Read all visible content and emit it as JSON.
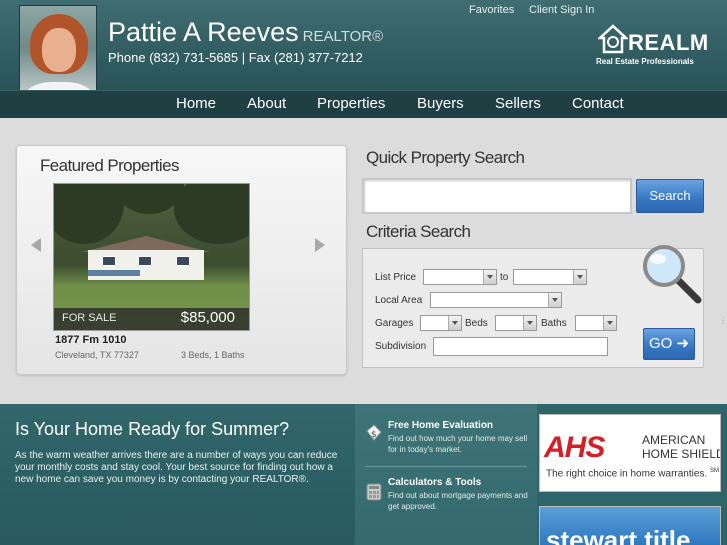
{
  "header": {
    "agent_name": "Pattie A Reeves",
    "designation": "REALTOR®",
    "contact_line": "Phone (832) 731-5685 | Fax (281) 377-7212",
    "top_links": [
      "Favorites",
      "Client Sign In"
    ],
    "logo": {
      "brand": "REALM",
      "tagline": "Real Estate Professionals"
    }
  },
  "nav": [
    "Home",
    "About",
    "Properties",
    "Buyers",
    "Sellers",
    "Contact"
  ],
  "featured": {
    "title": "Featured Properties",
    "status": "FOR SALE",
    "price": "$85,000",
    "address": "1877 Fm 1010",
    "city": "Cleveland, TX 77327",
    "beds_baths": "3 Beds, 1 Baths"
  },
  "quick_search": {
    "title": "Quick Property Search",
    "value": "",
    "button": "Search"
  },
  "criteria": {
    "title": "Criteria Search",
    "list_price": "List Price",
    "to": "to",
    "local_area": "Local Area",
    "garages": "Garages",
    "beds": "Beds",
    "baths": "Baths",
    "subdivision": "Subdivision",
    "go": "GO"
  },
  "promo": {
    "title": "Is Your Home Ready for Summer?",
    "body": "As the warm weather arrives there are a number of ways you can reduce your monthly costs and stay cool. Your best source for finding out how a new home can save you money is by contacting your REALTOR®."
  },
  "links": [
    {
      "title": "Free Home Evaluation",
      "desc": "Find out how much your home may sell for in today's market.",
      "icon": "dollar-tag-icon"
    },
    {
      "title": "Calculators & Tools",
      "desc": "Find out about mortgage payments and get approved.",
      "icon": "calculator-icon"
    }
  ],
  "ads": {
    "ahs": {
      "logo": "AHS",
      "name_line1": "AMERICAN",
      "name_line2": "HOME SHIELD",
      "tagline": "The right choice in home warranties.",
      "mark": "SM"
    },
    "stewart": "stewart title"
  },
  "colors": {
    "header": "#2d585d",
    "nav": "#203f43",
    "button_blue": "#3979c6",
    "ahs_red": "#d41f26"
  }
}
